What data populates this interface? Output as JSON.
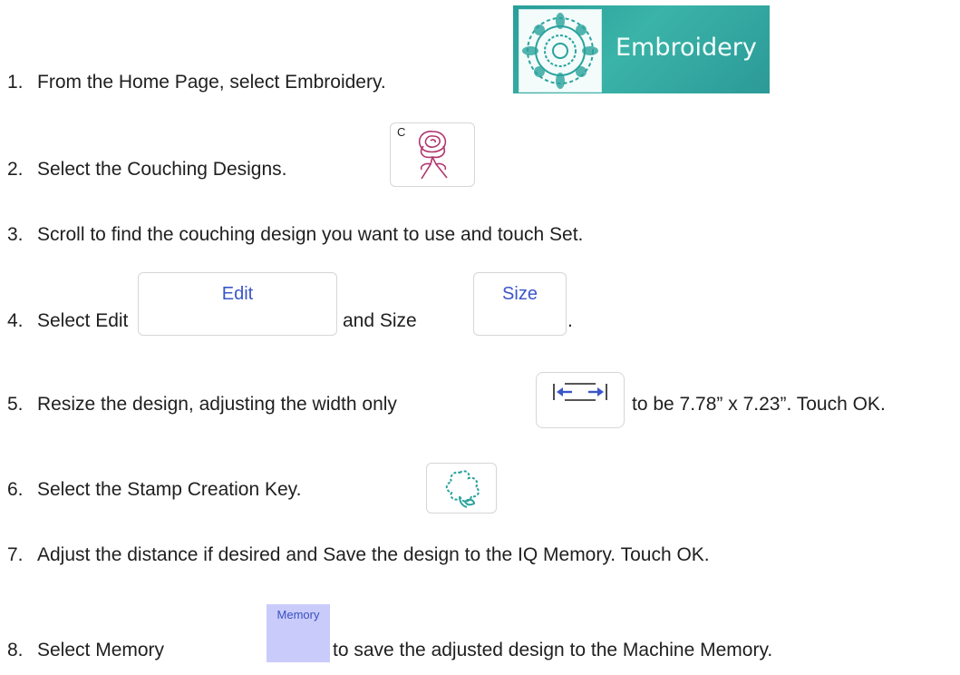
{
  "steps": [
    {
      "num": "1.",
      "text": "From the Home Page, select Embroidery."
    },
    {
      "num": "2.",
      "text": "Select the Couching Designs."
    },
    {
      "num": "3.",
      "text": "Scroll to find the couching design you want to use and touch Set."
    },
    {
      "num": "4.",
      "pre": "Select Edit",
      "mid": "and Size",
      "post": "."
    },
    {
      "num": "5.",
      "pre": "Resize the design, adjusting the width only",
      "post": "to be 7.78” x 7.23”. Touch OK."
    },
    {
      "num": "6.",
      "text": "Select the Stamp Creation Key."
    },
    {
      "num": "7.",
      "text": "Adjust the distance if desired  and Save the design to the IQ Memory.  Touch OK."
    },
    {
      "num": "8.",
      "pre": "Select Memory",
      "post": "to save the adjusted design to the Machine Memory."
    }
  ],
  "buttons": {
    "embroidery": "Embroidery",
    "couching_badge": "C",
    "edit": "Edit",
    "size": "Size",
    "memory": "Memory"
  },
  "colors": {
    "teal": "#2aa39d",
    "rose": "#b0356e",
    "blue_text": "#3a56c9",
    "memory_bg": "#c9ccfb"
  }
}
